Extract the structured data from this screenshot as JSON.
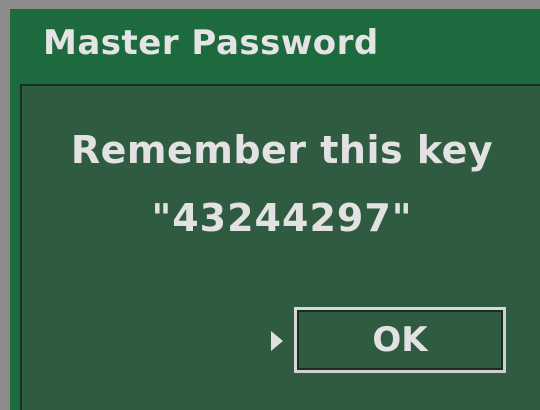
{
  "dialog": {
    "title": "Master Password",
    "message_line1": "Remember this key",
    "message_line2": "\"43244297\"",
    "ok_label": "OK"
  },
  "colors": {
    "title_bar": "#1e6a3f",
    "body_panel": "#2f5b41",
    "text": "#e2e2e2",
    "frame": "#8c8c8c"
  },
  "icons": {
    "focus_pointer": "triangle-right-icon"
  }
}
